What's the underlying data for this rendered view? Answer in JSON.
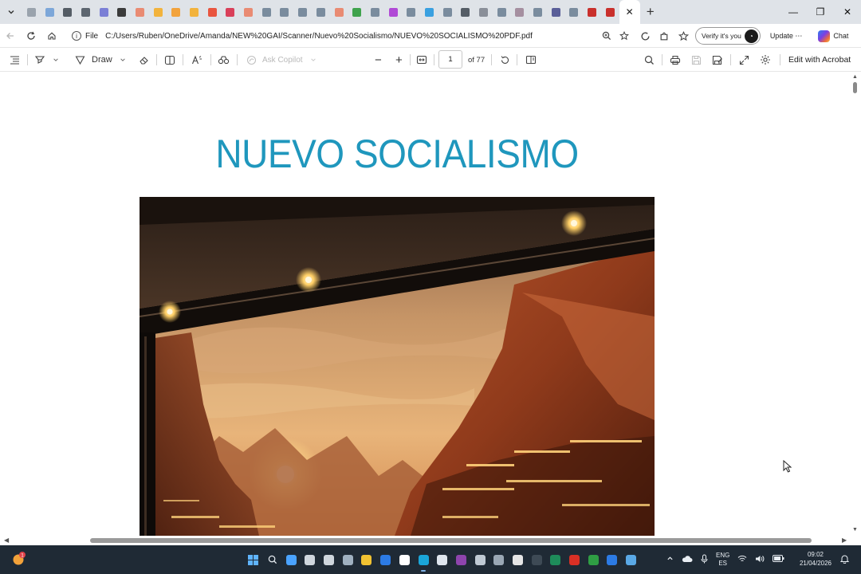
{
  "browser": {
    "tab_colors": [
      "#9aa3ad",
      "#7da7d9",
      "#555d66",
      "#5d6670",
      "#7b7fd6",
      "#3b3b3b",
      "#e98b73",
      "#f2b33d",
      "#f2a33d",
      "#f2b33d",
      "#e9553f",
      "#d9405a",
      "#e98b73",
      "#7a8c9e",
      "#7a8c9e",
      "#7a8c9e",
      "#7a8c9e",
      "#e98b73",
      "#3fa34d",
      "#7a8c9e",
      "#b04ad6",
      "#7a8c9e",
      "#3aa0e0",
      "#7a8c9e",
      "#555d66",
      "#8a8f99",
      "#7a8c9e",
      "#a58fa0",
      "#7a8c9e",
      "#5a5f99",
      "#7a8c9e",
      "#c9302c",
      "#c9302c"
    ],
    "active_tab_close": "✕",
    "new_tab": "+",
    "window_controls": {
      "minimize": "—",
      "restore": "❐",
      "close": "✕"
    },
    "address": {
      "scheme_label": "File",
      "url": "C:/Users/Ruben/OneDrive/Amanda/NEW%20GAI/Scanner/Nuevo%20Socialismo/NUEVO%20SOCIALISMO%20PDF.pdf"
    },
    "profile": {
      "label": "Verify it's you"
    },
    "update_label": "Update",
    "more_label": "⋯",
    "chat_label": "Chat"
  },
  "pdf_toolbar": {
    "draw_label": "Draw",
    "ask_copilot_label": "Ask Copilot",
    "zoom_out": "−",
    "zoom_in": "+",
    "page_current": "1",
    "page_total_label": "of 77",
    "edit_acrobat_label": "Edit with Acrobat"
  },
  "document": {
    "title": "NUEVO SOCIALISMO"
  },
  "taskbar": {
    "app_colors": [
      "#4aa3ff",
      "#cfd6dd",
      "#cfd6dd",
      "#9fb0c0",
      "#f1c232",
      "#2c7be5",
      "#ffffff",
      "#1aa6d9",
      "#dfe6ee",
      "#8e44ad",
      "#bfc9d3",
      "#9aa7b4",
      "#e5e5e5",
      "#3e4a55",
      "#1e8c5a",
      "#d93025",
      "#2f9e44",
      "#2c7be5",
      "#5aa9e6"
    ],
    "running_index": 7,
    "language": {
      "line1": "ENG",
      "line2": "ES"
    },
    "time": "09:02",
    "date": "21/04/2026"
  }
}
